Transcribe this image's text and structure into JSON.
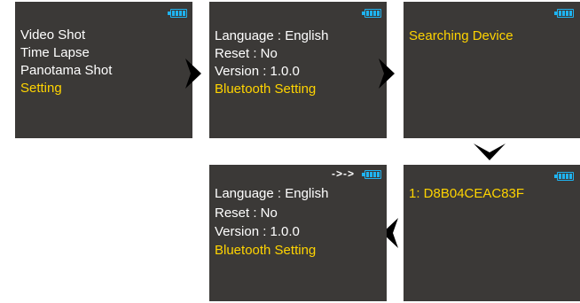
{
  "icons": {
    "battery": "battery-full-icon",
    "bluetooth_connection": "bluetooth-connected-icon",
    "arrow_right": "chevron-right-icon",
    "arrow_down": "chevron-down-icon",
    "arrow_left": "chevron-left-icon"
  },
  "colors": {
    "screen_bg": "#3b3937",
    "text": "#ffffff",
    "selected_text": "#ffd400",
    "battery": "#1fb3f0",
    "arrow": "#000000"
  },
  "battery_level": 1.0,
  "screens": {
    "main_menu": {
      "items": [
        "Video Shot",
        "Time Lapse",
        "Panotama Shot",
        "Setting"
      ],
      "selected_index": 3
    },
    "settings_menu": {
      "items": [
        "Language : English",
        "Reset : No",
        "Version : 1.0.0",
        "Bluetooth Setting"
      ],
      "selected_index": 3
    },
    "searching": {
      "items": [
        "Searching Device"
      ],
      "selected_index": 0
    },
    "device_found": {
      "items": [
        "1: D8B04CEAC83F"
      ],
      "selected_index": 0
    },
    "settings_connected": {
      "connection_indicator": "->->",
      "items": [
        "Language : English",
        "Reset : No",
        "Version : 1.0.0",
        "Bluetooth Setting"
      ],
      "selected_index": 3
    }
  }
}
